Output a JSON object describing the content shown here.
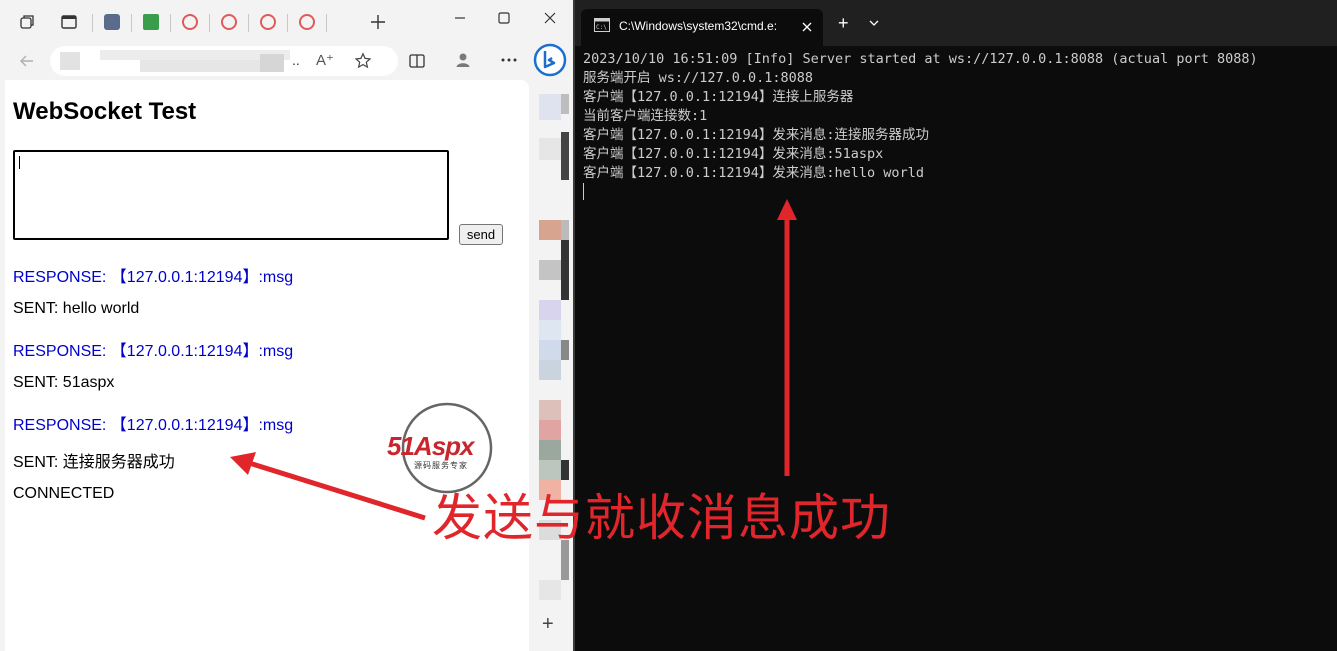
{
  "browser": {
    "page": {
      "title": "WebSocket Test",
      "input_value": "",
      "send_label": "send",
      "log": [
        {
          "type": "resp",
          "text": "RESPONSE: 【127.0.0.1:12194】:msg"
        },
        {
          "type": "sent",
          "text": "SENT: hello world"
        },
        {
          "type": "resp",
          "text": "RESPONSE: 【127.0.0.1:12194】:msg"
        },
        {
          "type": "sent",
          "text": "SENT: 51aspx"
        },
        {
          "type": "resp",
          "text": "RESPONSE: 【127.0.0.1:12194】:msg"
        },
        {
          "type": "sent",
          "text": "SENT: 连接服务器成功"
        },
        {
          "type": "sent",
          "text": "CONNECTED"
        }
      ]
    },
    "url_ellipsis": "..",
    "add_label": "+"
  },
  "terminal": {
    "tab_title": "C:\\Windows\\system32\\cmd.e:",
    "new_tab_label": "+",
    "lines": [
      "2023/10/10 16:51:09 [Info] Server started at ws://127.0.0.1:8088 (actual port 8088)",
      "服务端开启 ws://127.0.0.1:8088",
      "客户端【127.0.0.1:12194】连接上服务器",
      "当前客户端连接数:1",
      "客户端【127.0.0.1:12194】发来消息:连接服务器成功",
      "客户端【127.0.0.1:12194】发来消息:51aspx",
      "客户端【127.0.0.1:12194】发来消息:hello world"
    ]
  },
  "watermark": {
    "brand": "51Aspx",
    "tagline": "源码服务专家"
  },
  "annotation": {
    "text": "发送与就收消息成功",
    "color": "#e0262b"
  },
  "colors": {
    "response_text": "#0000cc",
    "terminal_bg": "#0c0c0c",
    "terminal_text": "#cccccc"
  }
}
